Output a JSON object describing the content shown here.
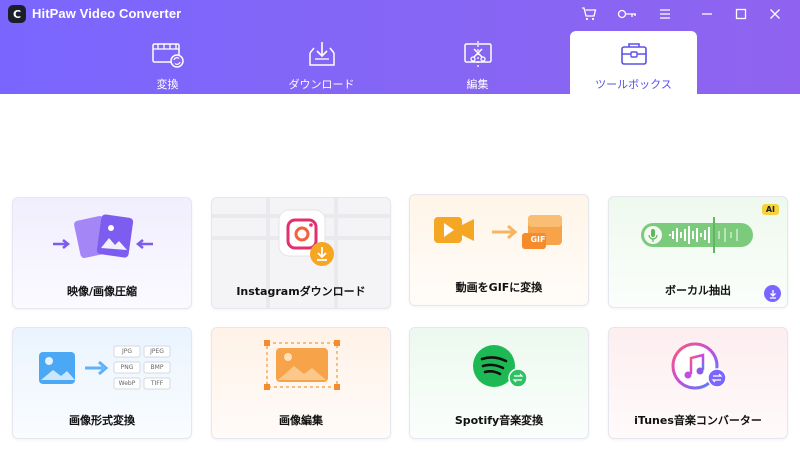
{
  "app": {
    "title": "HitPaw Video Converter",
    "logo_letter": "C"
  },
  "tabs": [
    {
      "label": "変換",
      "icon": "film-convert-icon",
      "active": false
    },
    {
      "label": "ダウンロード",
      "icon": "download-tray-icon",
      "active": false
    },
    {
      "label": "編集",
      "icon": "edit-cut-icon",
      "active": false
    },
    {
      "label": "ツールボックス",
      "icon": "toolbox-icon",
      "active": true
    }
  ],
  "titlebar_icons": [
    "cart-icon",
    "key-icon",
    "menu-icon",
    "minimize-icon",
    "maximize-icon",
    "close-icon"
  ],
  "tools": [
    {
      "label": "映像/画像圧縮",
      "icon": "compress-image-icon"
    },
    {
      "label": "Instagramダウンロード",
      "icon": "instagram-icon"
    },
    {
      "label": "動画をGIFに変換",
      "icon": "video-to-gif-icon"
    },
    {
      "label": "ボーカル抽出",
      "icon": "vocal-wave-icon",
      "badge": "AI"
    },
    {
      "label": "画像形式変換",
      "icon": "image-format-icon",
      "formats": [
        "JPG",
        "JPEG",
        "PNG",
        "BMP",
        "WebP",
        "TIFF"
      ]
    },
    {
      "label": "画像編集",
      "icon": "image-edit-icon"
    },
    {
      "label": "Spotify音楽変換",
      "icon": "spotify-icon"
    },
    {
      "label": "iTunes音楽コンバーター",
      "icon": "itunes-icon"
    }
  ],
  "gif_label": "GIF",
  "colors": {
    "accent": "#7a66ff",
    "active_tab_text": "#5a52e8"
  }
}
